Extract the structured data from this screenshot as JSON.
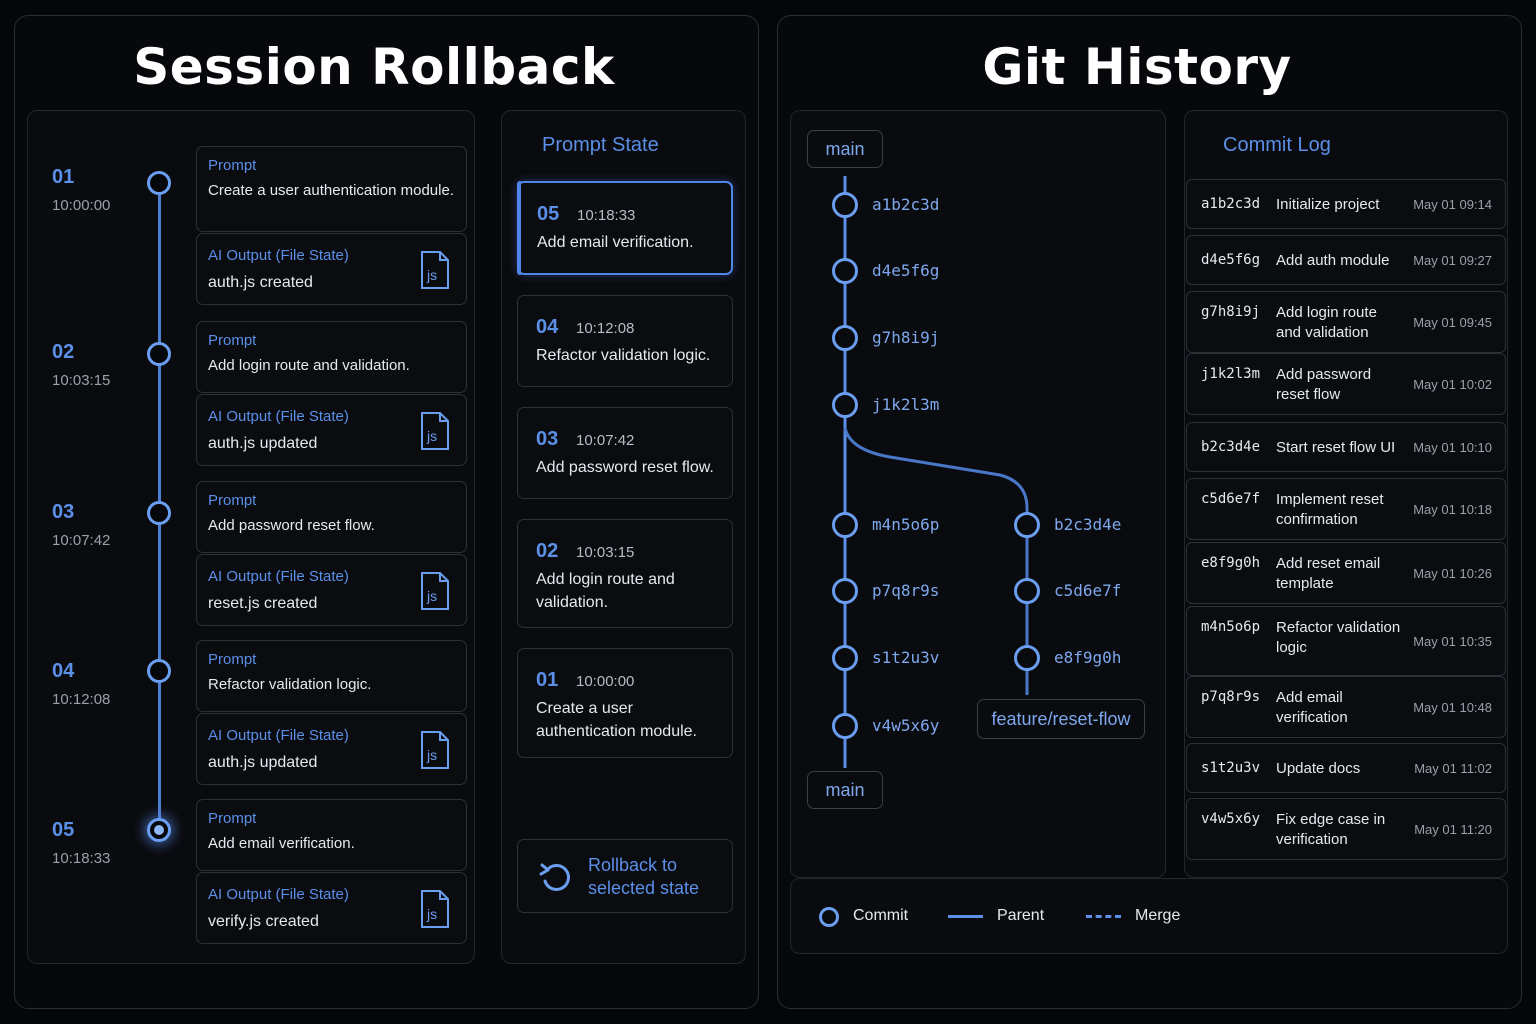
{
  "session": {
    "title": "Session Rollback",
    "steps": [
      {
        "num": "01",
        "time": "10:00:00",
        "prompt_label": "Prompt",
        "prompt": "Create a user authentication module.",
        "output_label": "AI Output (File State)",
        "output": "auth.js created",
        "file_icon": "js"
      },
      {
        "num": "02",
        "time": "10:03:15",
        "prompt_label": "Prompt",
        "prompt": "Add login route and validation.",
        "output_label": "AI Output (File State)",
        "output": "auth.js updated",
        "file_icon": "js"
      },
      {
        "num": "03",
        "time": "10:07:42",
        "prompt_label": "Prompt",
        "prompt": "Add password reset flow.",
        "output_label": "AI Output (File State)",
        "output": "reset.js created",
        "file_icon": "js"
      },
      {
        "num": "04",
        "time": "10:12:08",
        "prompt_label": "Prompt",
        "prompt": "Refactor validation logic.",
        "output_label": "AI Output (File State)",
        "output": "auth.js updated",
        "file_icon": "js"
      },
      {
        "num": "05",
        "time": "10:18:33",
        "prompt_label": "Prompt",
        "prompt": "Add email verification.",
        "output_label": "AI Output (File State)",
        "output": "verify.js created",
        "file_icon": "js"
      }
    ]
  },
  "prompt_state": {
    "title": "Prompt State",
    "items": [
      {
        "num": "05",
        "time": "10:18:33",
        "text": "Add email verification.",
        "selected": true
      },
      {
        "num": "04",
        "time": "10:12:08",
        "text": "Refactor validation logic.",
        "selected": false
      },
      {
        "num": "03",
        "time": "10:07:42",
        "text": "Add password reset flow.",
        "selected": false
      },
      {
        "num": "02",
        "time": "10:03:15",
        "text": "Add login route and validation.",
        "selected": false
      },
      {
        "num": "01",
        "time": "10:00:00",
        "text": "Create a user authentication module.",
        "selected": false
      }
    ],
    "rollback_label": "Rollback to selected state",
    "rollback_icon": "undo-icon"
  },
  "git": {
    "title": "Git History",
    "branch_main": "main",
    "branch_main_bottom": "main",
    "branch_feature": "feature/reset-flow",
    "main_commits": [
      "a1b2c3d",
      "d4e5f6g",
      "g7h8i9j",
      "j1k2l3m",
      "m4n5o6p",
      "p7q8r9s",
      "s1t2u3v",
      "v4w5x6y"
    ],
    "feature_commits": [
      "b2c3d4e",
      "c5d6e7f",
      "e8f9g0h"
    ],
    "legend": {
      "commit": "Commit",
      "parent": "Parent",
      "merge": "Merge"
    },
    "accent": "#5b8fe8"
  },
  "commit_log": {
    "title": "Commit Log",
    "rows": [
      {
        "hash": "a1b2c3d",
        "msg": "Initialize project",
        "date": "May 01 09:14"
      },
      {
        "hash": "d4e5f6g",
        "msg": "Add auth module",
        "date": "May 01 09:27"
      },
      {
        "hash": "g7h8i9j",
        "msg": "Add login route and validation",
        "date": "May 01 09:45"
      },
      {
        "hash": "j1k2l3m",
        "msg": "Add password reset flow",
        "date": "May 01 10:02"
      },
      {
        "hash": "b2c3d4e",
        "msg": "Start reset flow UI",
        "date": "May 01 10:10"
      },
      {
        "hash": "c5d6e7f",
        "msg": "Implement reset confirmation",
        "date": "May 01 10:18"
      },
      {
        "hash": "e8f9g0h",
        "msg": "Add reset email template",
        "date": "May 01 10:26"
      },
      {
        "hash": "m4n5o6p",
        "msg": "Refactor validation logic",
        "date": "May 01 10:35"
      },
      {
        "hash": "p7q8r9s",
        "msg": "Add email verification",
        "date": "May 01 10:48"
      },
      {
        "hash": "s1t2u3v",
        "msg": "Update docs",
        "date": "May 01 11:02"
      },
      {
        "hash": "v4w5x6y",
        "msg": "Fix edge case in verification",
        "date": "May 01 11:20"
      }
    ]
  }
}
